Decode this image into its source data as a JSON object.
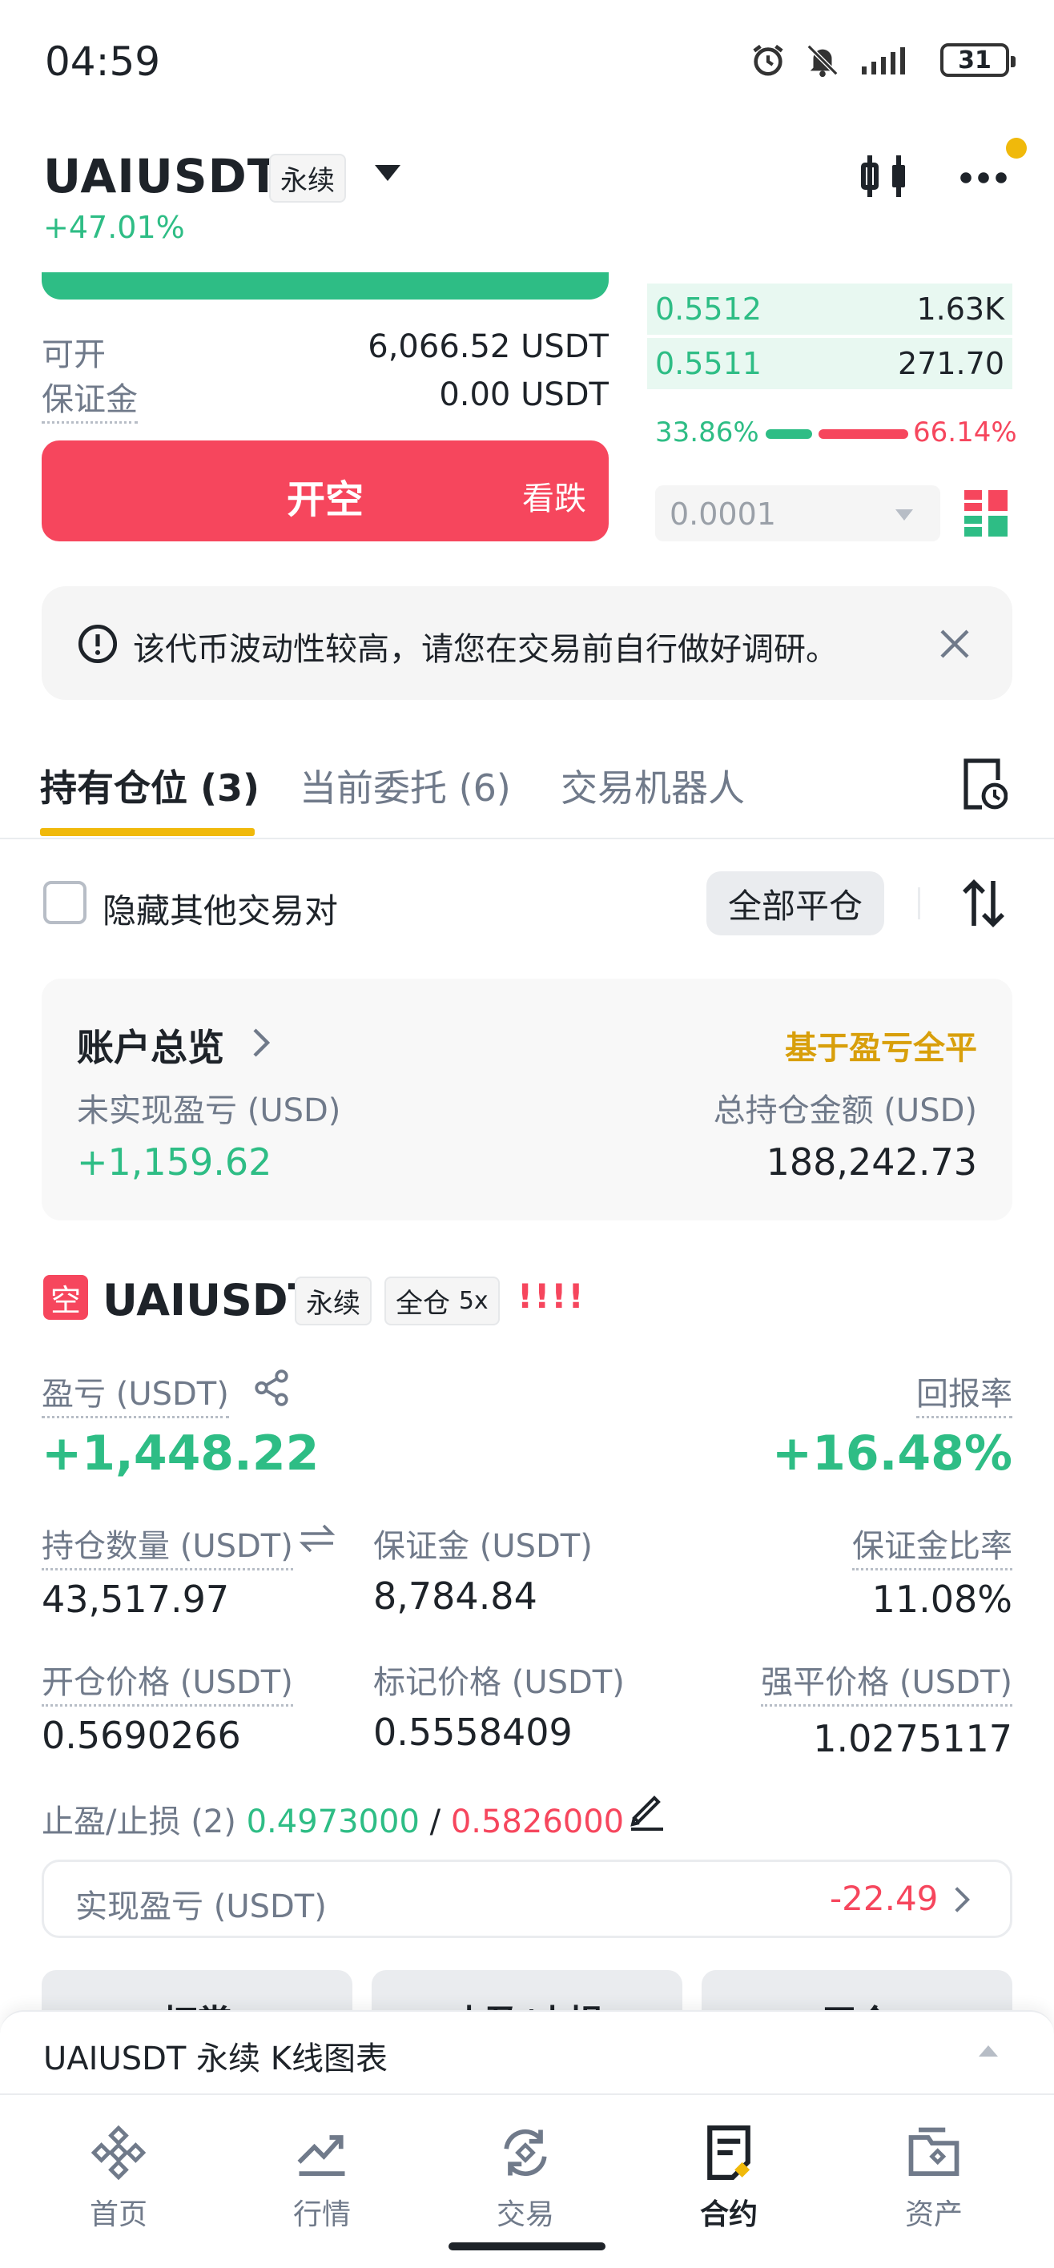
{
  "status_bar": {
    "time": "04:59",
    "battery": "31"
  },
  "header": {
    "symbol": "UAIUSDT",
    "tag": "永续",
    "change": "+47.01%"
  },
  "order_form": {
    "available_label": "可开",
    "available_value": "6,066.52 USDT",
    "margin_label": "保证金",
    "margin_value": "0.00 USDT",
    "sell_label": "开空",
    "sell_sub": "看跌"
  },
  "order_book": {
    "bids": [
      {
        "price": "0.5512",
        "qty": "1.63K"
      },
      {
        "price": "0.5511",
        "qty": "271.70"
      }
    ],
    "buy_ratio": "33.86%",
    "sell_ratio": "66.14%",
    "buy_ratio_value": 33.86,
    "tick_size": "0.0001"
  },
  "notice": {
    "text": "该代币波动性较高，请您在交易前自行做好调研。"
  },
  "tabs": [
    {
      "label": "持有仓位 (3)"
    },
    {
      "label": "当前委托 (6)"
    },
    {
      "label": "交易机器人"
    }
  ],
  "filter": {
    "hide_label": "隐藏其他交易对",
    "close_all": "全部平仓"
  },
  "overview": {
    "title": "账户总览",
    "link": "基于盈亏全平",
    "unrealized_label": "未实现盈亏 (USD)",
    "unrealized_value": "+1,159.62",
    "total_label": "总持仓金额 (USD)",
    "total_value": "188,242.73"
  },
  "position": {
    "side": "空",
    "symbol": "UAIUSDT",
    "tag1": "永续",
    "tag2_text": "全仓",
    "tag2_lev": "5x",
    "warn": "!!!!",
    "pnl_label": "盈亏 (USDT)",
    "pnl_value": "+1,448.22",
    "roi_label": "回报率",
    "roi_value": "+16.48%",
    "size_label": "持仓数量 (USDT)",
    "size_value": "43,517.97",
    "margin_label": "保证金 (USDT)",
    "margin_value": "8,784.84",
    "margin_ratio_label": "保证金比率",
    "margin_ratio_value": "11.08%",
    "entry_label": "开仓价格 (USDT)",
    "entry_value": "0.5690266",
    "mark_label": "标记价格 (USDT)",
    "mark_value": "0.5558409",
    "liq_label": "强平价格 (USDT)",
    "liq_value": "1.0275117",
    "tpsl_label": "止盈/止损 (2)",
    "tp_value": "0.4973000",
    "slash": "/",
    "sl_value": "0.5826000",
    "realized_label": "实现盈亏 (USDT)",
    "realized_value": "-22.49",
    "actions": [
      "打赏",
      "止盈/止损",
      "平仓"
    ]
  },
  "chart_bar": {
    "title": "UAIUSDT 永续 K线图表"
  },
  "nav": [
    {
      "label": "首页",
      "icon": "home-icon"
    },
    {
      "label": "行情",
      "icon": "markets-icon"
    },
    {
      "label": "交易",
      "icon": "trade-icon"
    },
    {
      "label": "合约",
      "icon": "futures-icon"
    },
    {
      "label": "资产",
      "icon": "wallet-icon"
    }
  ],
  "colors": {
    "green": "#2ebd85",
    "red": "#f6465d",
    "accent": "#f0b90b"
  }
}
